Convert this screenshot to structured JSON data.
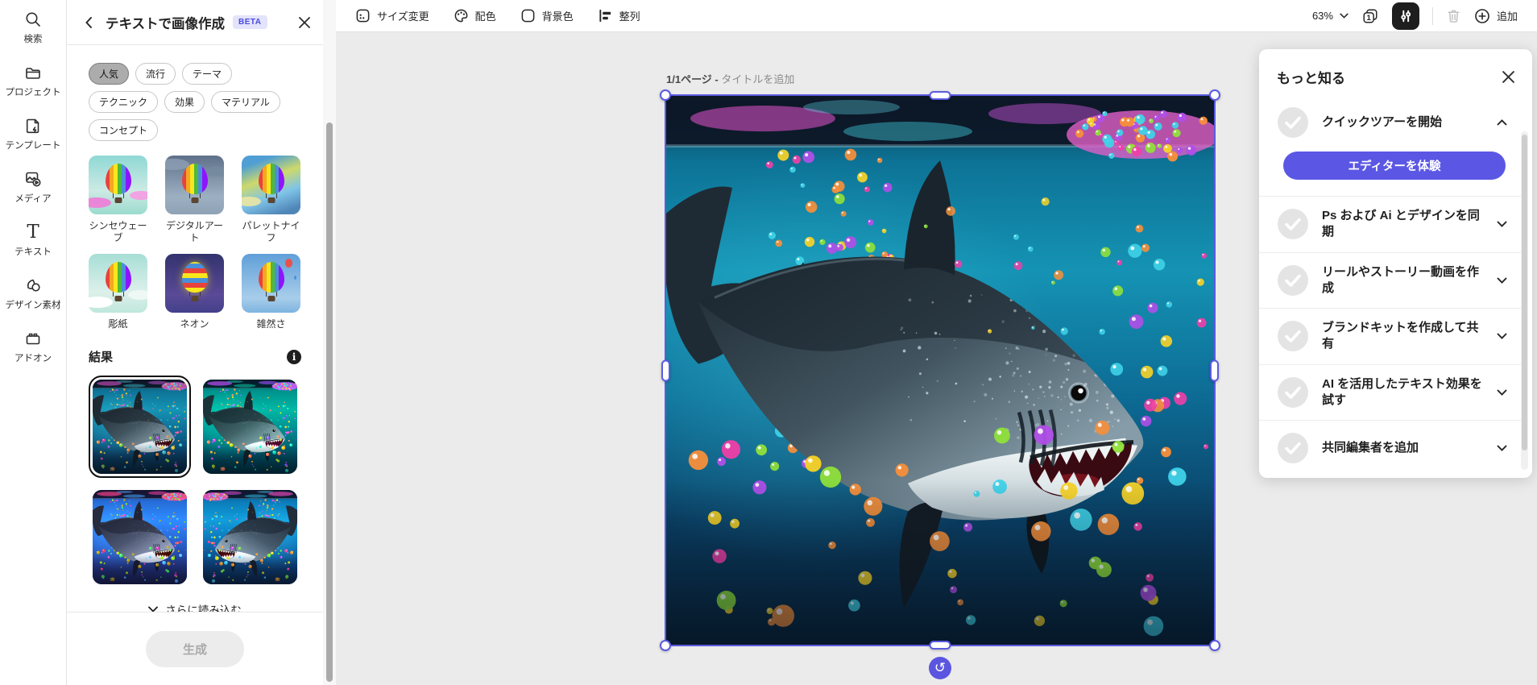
{
  "rail": {
    "items": [
      "検索",
      "プロジェクト",
      "テンプレート",
      "メディア",
      "テキスト",
      "デザイン素材",
      "アドオン"
    ]
  },
  "panel": {
    "title": "テキストで画像作成",
    "beta_badge": "BETA",
    "filters": [
      "人気",
      "流行",
      "テーマ",
      "テクニック",
      "効果",
      "マテリアル",
      "コンセプト"
    ],
    "selected_filter": "人気",
    "styles": [
      "シンセウェーブ",
      "デジタルアート",
      "パレットナイフ",
      "彫紙",
      "ネオン",
      "雑然さ"
    ],
    "results_heading": "結果",
    "results_count": 4,
    "selected_result_index": 0,
    "load_more": "さらに読み込む",
    "generate_label": "生成",
    "generate_enabled": false
  },
  "toolbar": {
    "resize": "サイズ変更",
    "palette": "配色",
    "background": "背景色",
    "align": "整列",
    "zoom": "63%",
    "add": "追加"
  },
  "canvas": {
    "page_indicator": "1/1ページ -",
    "title_placeholder": "タイトルを追加"
  },
  "learn_panel": {
    "title": "もっと知る",
    "items": [
      {
        "label": "クイックツアーを開始",
        "state": "expanded",
        "cta": "エディターを体験"
      },
      {
        "label": "Ps および Ai とデザインを同期",
        "state": "collapsed"
      },
      {
        "label": "リールやストーリー動画を作成",
        "state": "collapsed"
      },
      {
        "label": "ブランドキットを作成して共有",
        "state": "collapsed"
      },
      {
        "label": "AI を活用したテキスト効果を試す",
        "state": "collapsed"
      },
      {
        "label": "共同編集者を追加",
        "state": "collapsed"
      }
    ]
  },
  "colors": {
    "accent_purple": "#5b57e4",
    "selection_purple": "#5b5be0",
    "beta_bg": "#e3e3fb",
    "beta_text": "#4a4ae0",
    "canvas_bg": "#ebebeb",
    "disabled_button_bg": "#ececec",
    "disabled_button_text": "#a9a9a9"
  },
  "icons": {
    "rotate": "↺",
    "close": "✕",
    "back": "‹",
    "info": "i"
  }
}
